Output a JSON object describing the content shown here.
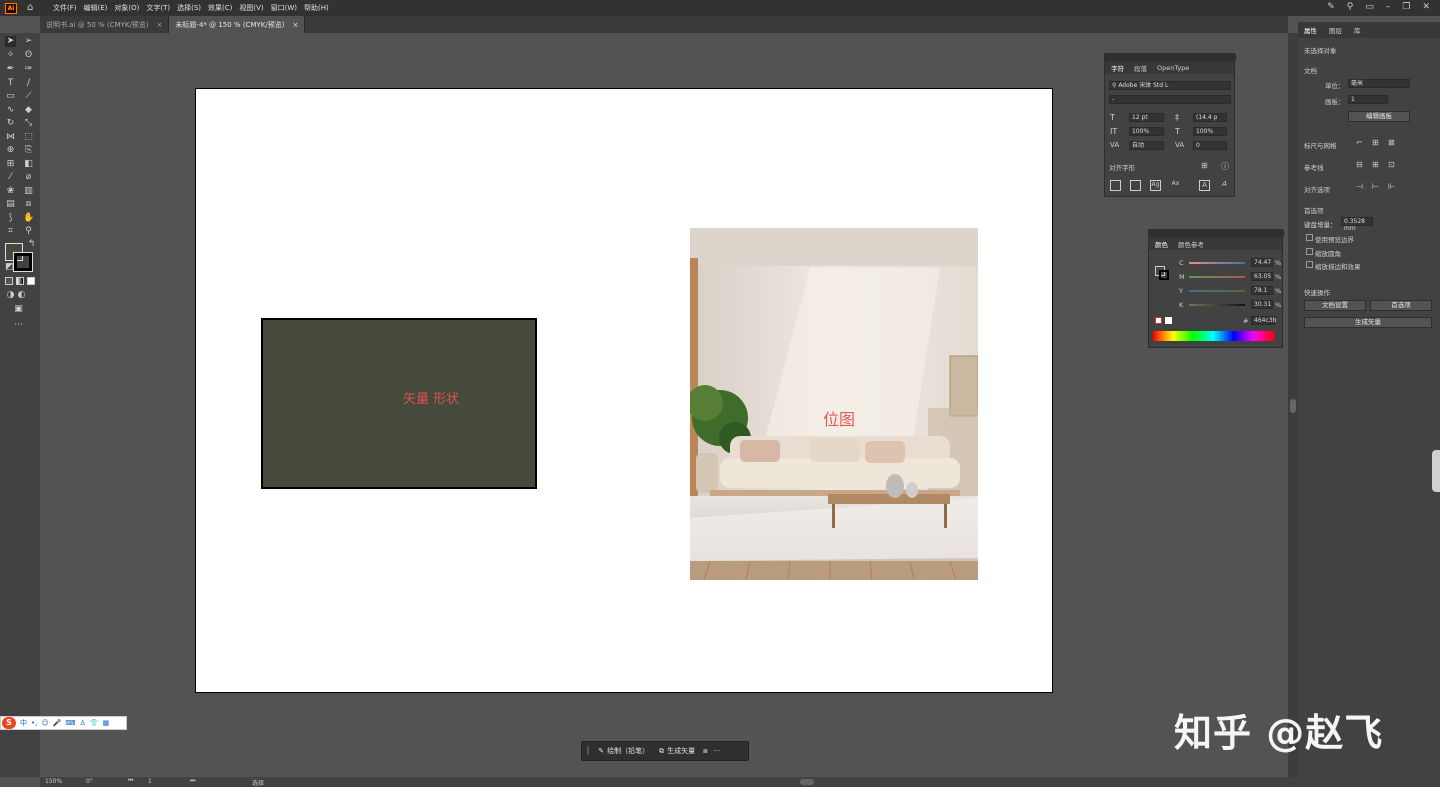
{
  "app": {
    "logo_text": "Ai",
    "menus": [
      "文件(F)",
      "编辑(E)",
      "对象(O)",
      "文字(T)",
      "选择(S)",
      "效果(C)",
      "视图(V)",
      "窗口(W)",
      "帮助(H)"
    ]
  },
  "tabs": [
    {
      "label": "说明书.ai @ 50 % (CMYK/预览)",
      "close": "×"
    },
    {
      "label": "未标题-4* @ 150 % (CMYK/预览)",
      "close": "×"
    }
  ],
  "canvas": {
    "vector_label": "矢量 形状",
    "vector_fill": "#454a3c",
    "bitmap_label": "位图"
  },
  "character_panel": {
    "tabs": [
      "字符",
      "段落",
      "OpenType"
    ],
    "font_family": "Adobe 宋体 Std L",
    "font_style": "-",
    "size": "12 pt",
    "leading": "(14.4 p",
    "vscale": "100%",
    "hscale": "100%",
    "kerning": "自动",
    "tracking": "0",
    "align_glyph_label": "对齐字形"
  },
  "color_panel": {
    "tabs": [
      "颜色",
      "颜色参考"
    ],
    "channels": [
      {
        "name": "C",
        "value": "74.47",
        "unit": "%"
      },
      {
        "name": "M",
        "value": "63.05",
        "unit": "%"
      },
      {
        "name": "Y",
        "value": "78.1",
        "unit": "%"
      },
      {
        "name": "K",
        "value": "30.31",
        "unit": "%"
      }
    ],
    "hex_symbol": "#",
    "hex": "464c3b"
  },
  "properties": {
    "tabs": [
      "属性",
      "图层",
      "库"
    ],
    "no_selection": "未选择对象",
    "document_header": "文档",
    "unit_label": "单位：",
    "unit_value": "毫米",
    "artboard_label": "画板：",
    "artboard_value": "1",
    "edit_artboard": "编辑画板",
    "rulers_grid": "标尺与网格",
    "guides": "参考线",
    "align_options": "对齐选项",
    "preferences_header": "首选项",
    "keyboard_increment_label": "键盘增量：",
    "keyboard_increment_value": "0.3528 mm",
    "check_preview_bounds": "使用预览边界",
    "check_scale_corners": "缩放圆角",
    "check_scale_strokes": "缩放描边和效果",
    "quick_actions": "快速操作",
    "doc_setup_btn": "文档设置",
    "prefs_btn": "首选项",
    "generate_vector_btn": "生成矢量"
  },
  "floatbar": {
    "draw_label": "绘制（铅笔）",
    "generate_label": "生成矢量",
    "more": "···"
  },
  "status": {
    "zoom": "150%",
    "rotation": "0°",
    "artboard": "1",
    "tool": "选择"
  },
  "ime": {
    "lang": "中"
  },
  "watermark": "知乎 @赵飞"
}
